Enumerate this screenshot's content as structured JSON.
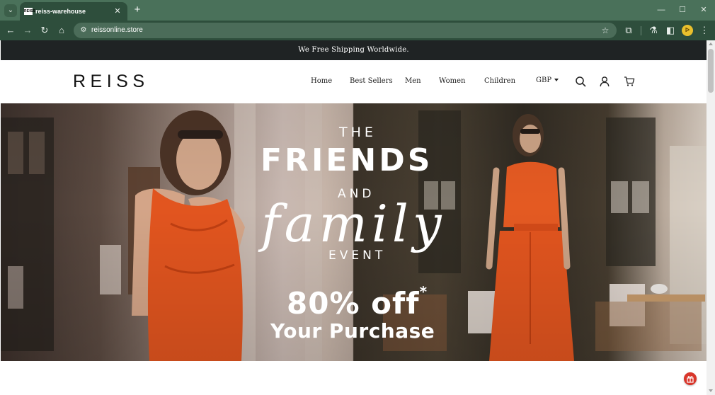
{
  "browser": {
    "tab": {
      "favicon_text": "REISS",
      "title": "reiss-warehouse",
      "close_glyph": "✕"
    },
    "tab_menu_glyph": "⌄",
    "new_tab_glyph": "+",
    "window_controls": {
      "minimize": "—",
      "maximize": "☐",
      "close": "✕"
    },
    "toolbar": {
      "back_glyph": "←",
      "forward_glyph": "→",
      "reload_glyph": "↻",
      "home_glyph": "⌂",
      "url": "reissonline.store",
      "site_info_glyph": "⚙",
      "star_glyph": "☆",
      "extensions_glyph": "⧉",
      "labs_glyph": "⚗",
      "sidepanel_glyph": "◧",
      "profile_glyph": "ᐅ",
      "menu_glyph": "⋮"
    },
    "icons": {
      "tab_menu": "chevron-down-icon",
      "favicon": "reiss-favicon-icon",
      "tab_close": "close-icon",
      "new_tab": "plus-icon",
      "back": "arrow-left-icon",
      "forward": "arrow-right-icon",
      "reload": "reload-icon",
      "home": "home-icon",
      "site_info": "site-settings-icon",
      "star": "star-icon",
      "extensions": "puzzle-icon",
      "labs": "flask-icon",
      "sidepanel": "side-panel-icon",
      "profile": "profile-avatar-icon",
      "menu": "kebab-menu-icon"
    }
  },
  "page": {
    "announcement": "We Free Shipping Worldwide.",
    "logo": "REISS",
    "nav": [
      "Home",
      "Best Sellers",
      "Men",
      "Women",
      "Children"
    ],
    "currency": "GBP",
    "header_icons": [
      "search-icon",
      "user-icon",
      "cart-icon"
    ],
    "hero": {
      "line1": "THE",
      "line2": "FRIENDS",
      "line3": "AND",
      "line4": "family",
      "line5": "EVENT",
      "offer": "80% off",
      "offer_mark": "*",
      "offer_sub": "Your Purchase"
    },
    "promo_badge_icon": "gift-icon"
  },
  "colors": {
    "tab_strip": "#4a715a",
    "toolbar": "#2e4e3c",
    "announcement_bar": "#1f2324",
    "hero_text": "#ffffff",
    "dress_orange": "#e2551f",
    "badge": "#d9362b"
  }
}
